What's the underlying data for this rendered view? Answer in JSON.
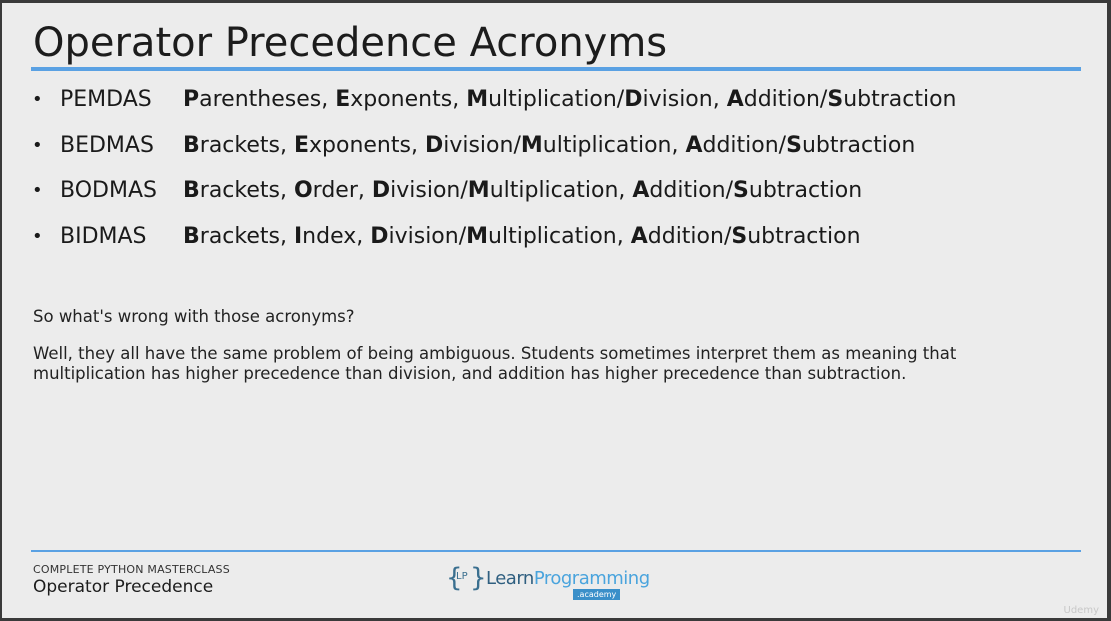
{
  "slide": {
    "title": "Operator Precedence Acronyms",
    "bullet_char": "•",
    "acronyms": [
      {
        "name": "PEMDAS",
        "parts": [
          {
            "b": "P",
            "t": "arentheses, "
          },
          {
            "b": "E",
            "t": "xponents, "
          },
          {
            "b": "M",
            "t": "ultiplication/"
          },
          {
            "b": "D",
            "t": "ivision, "
          },
          {
            "b": "A",
            "t": "ddition/"
          },
          {
            "b": "S",
            "t": "ubtraction"
          }
        ]
      },
      {
        "name": "BEDMAS",
        "parts": [
          {
            "b": "B",
            "t": "rackets, "
          },
          {
            "b": "E",
            "t": "xponents, "
          },
          {
            "b": "D",
            "t": "ivision/"
          },
          {
            "b": "M",
            "t": "ultiplication, "
          },
          {
            "b": "A",
            "t": "ddition/"
          },
          {
            "b": "S",
            "t": "ubtraction"
          }
        ]
      },
      {
        "name": "BODMAS",
        "parts": [
          {
            "b": "B",
            "t": "rackets, "
          },
          {
            "b": "O",
            "t": "rder, "
          },
          {
            "b": "D",
            "t": "ivision/"
          },
          {
            "b": "M",
            "t": "ultiplication, "
          },
          {
            "b": "A",
            "t": "ddition/"
          },
          {
            "b": "S",
            "t": "ubtraction"
          }
        ]
      },
      {
        "name": "BIDMAS",
        "parts": [
          {
            "b": "B",
            "t": "rackets, "
          },
          {
            "b": "I",
            "t": "ndex, "
          },
          {
            "b": "D",
            "t": "ivision/"
          },
          {
            "b": "M",
            "t": "ultiplication, "
          },
          {
            "b": "A",
            "t": "ddition/"
          },
          {
            "b": "S",
            "t": "ubtraction"
          }
        ]
      }
    ],
    "question": "So what's wrong with those acronyms?",
    "answer_line1": "Well, they all have the same problem of being ambiguous.  Students sometimes interpret them as meaning that",
    "answer_line2": "multiplication has higher precedence than division, and addition has higher precedence than subtraction."
  },
  "footer": {
    "course": "COMPLETE PYTHON MASTERCLASS",
    "section": "Operator Precedence",
    "logo": {
      "brace_left": "{",
      "brace_right": "}",
      "initials": "LP",
      "learn": "Learn",
      "programming": "Programming",
      "academy": ".academy"
    }
  },
  "watermark": "Udemy",
  "colors": {
    "accent_rule": "#5aa1e3",
    "background": "#ececec",
    "text": "#1a1a1a"
  }
}
